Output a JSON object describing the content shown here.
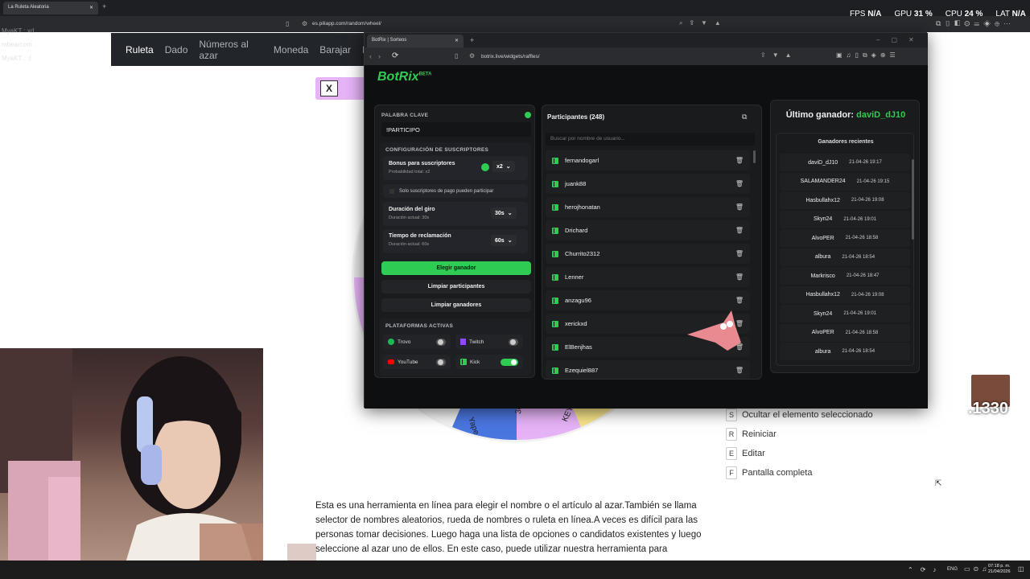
{
  "bg_browser": {
    "tab_title": "La Ruleta Aleatoria",
    "url": "es.piliapp.com/random/wheel/"
  },
  "perf": {
    "fps_label": "FPS",
    "fps": "N/A",
    "gpu_label": "GPU",
    "gpu": "31 %",
    "cpu_label": "CPU",
    "cpu": "24 %",
    "lat_label": "LAT",
    "lat": "N/A"
  },
  "chat_overlay": [
    "MyaKT : xd",
    "mbearcom : ",
    "MyaKT : :("
  ],
  "site_nav": [
    "Ruleta",
    "Dado",
    "Números al azar",
    "Moneda",
    "Barajar",
    "E"
  ],
  "x_button": "X",
  "wheel_labels": [
    "Yape",
    "30 subs",
    "KEY"
  ],
  "shortcuts": [
    {
      "key": "S",
      "label": "Ocultar el elemento seleccionado"
    },
    {
      "key": "R",
      "label": "Reiniciar"
    },
    {
      "key": "E",
      "label": "Editar"
    },
    {
      "key": "F",
      "label": "Pantalla completa"
    }
  ],
  "description": "Esta es una herramienta en línea para elegir el nombre o el artículo al azar.También se llama selector de nombres aleatorios, rueda de nombres o ruleta en línea.A veces es difícil para las personas tomar decisiones. Luego haga una lista de opciones o candidatos existentes y luego seleccione al azar uno de ellos. En este caso, puede utilizar nuestra herramienta para",
  "overlay_counter": ".1330",
  "botrix": {
    "tab_title": "BotRix | Sorteos",
    "url": "botrix.live/widgets/raffles/",
    "logo": "BotRix",
    "logo_badge": "BETA",
    "keyword_label": "PALABRA CLAVE",
    "keyword_value": "!PARTICIPO",
    "subs_config_label": "CONFIGURACIÓN DE SUSCRIPTORES",
    "bonus_title": "Bonus para suscriptores",
    "bonus_sub": "Probabilidad total: x2",
    "bonus_value": "x2",
    "only_paid_subs": "Solo suscriptores de pago pueden participar",
    "spin_title": "Duración del giro",
    "spin_sub": "Duración actual: 30s",
    "spin_value": "30s",
    "claim_title": "Tiempo de reclamación",
    "claim_sub": "Duración actual: 60s",
    "claim_value": "60s",
    "pick_winner": "Elegir ganador",
    "clear_participants": "Limpiar participantes",
    "clear_winners": "Limpiar ganadores",
    "platforms_label": "PLATAFORMAS ACTIVAS",
    "platforms": [
      {
        "name": "Trovo",
        "color": "#1db954",
        "on": false
      },
      {
        "name": "Twitch",
        "color": "#9146ff",
        "on": false
      },
      {
        "name": "YouTube",
        "color": "#ff0000",
        "on": false
      },
      {
        "name": "Kick",
        "color": "#2ecc52",
        "on": true
      }
    ],
    "participants_title": "Participantes (248)",
    "search_placeholder": "Buscar por nombre de usuario...",
    "participants": [
      "fernandogarl",
      "juank88",
      "herojhonatan",
      "Drichard",
      "Churrito2312",
      "Lenner",
      "anzagu96",
      "xerickxd",
      "ElBenjhas",
      "Ezequiel887"
    ],
    "last_winner_label": "Último ganador:",
    "last_winner": "daviD_dJ10",
    "recent_winners_title": "Ganadores recientes",
    "recent_winners": [
      {
        "name": "daviD_dJ10",
        "date": "21-04-26 19:17"
      },
      {
        "name": "SALAMANDER24",
        "date": "21-04-26 19:15"
      },
      {
        "name": "Hasbullahx12",
        "date": "21-04-26 19:08"
      },
      {
        "name": "Skyn24",
        "date": "21-04-26 19:01"
      },
      {
        "name": "AlvoPER",
        "date": "21-04-26 18:58"
      },
      {
        "name": "albura",
        "date": "21-04-26 18:54"
      },
      {
        "name": "Markrisco",
        "date": "21-04-26 18:47"
      },
      {
        "name": "Hasbullahx12",
        "date": "21-04-26 19:08"
      },
      {
        "name": "Skyn24",
        "date": "21-04-26 19:01"
      },
      {
        "name": "AlvoPER",
        "date": "21-04-26 18:58"
      },
      {
        "name": "albura",
        "date": "21-04-26 18:54"
      }
    ]
  },
  "taskbar": {
    "lang": "ENG",
    "time": "07:18 p. m.",
    "date": "21/04/2026"
  },
  "colors": {
    "accent": "#2ecc52",
    "wheel_pink": "#e6b3f7"
  }
}
